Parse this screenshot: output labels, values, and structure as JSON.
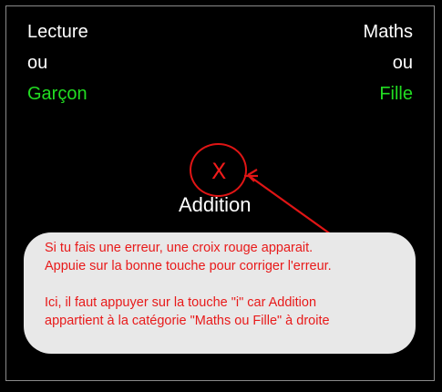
{
  "left_category": {
    "line1": "Lecture",
    "line2": "ou",
    "line3": "Garçon"
  },
  "right_category": {
    "line1": "Maths",
    "line2": "ou",
    "line3": "Fille"
  },
  "feedback": {
    "error_mark": "X",
    "stimulus": "Addition"
  },
  "tooltip": {
    "line1": "Si tu fais une erreur, une croix rouge apparait.",
    "line2": "Appuie sur la bonne touche pour corriger l'erreur.",
    "line3": "Ici, il faut appuyer sur la touche \"i\" car Addition",
    "line4": "appartient à la catégorie \"Maths ou Fille\" à droite"
  },
  "colors": {
    "background": "#000000",
    "category_text": "#ffffff",
    "category_accent": "#22dd22",
    "error": "#e01515",
    "tooltip_bg": "#e8e8e8"
  },
  "icons": {
    "error_mark": "red-x-icon",
    "annotation_arrow": "arrow-icon"
  }
}
